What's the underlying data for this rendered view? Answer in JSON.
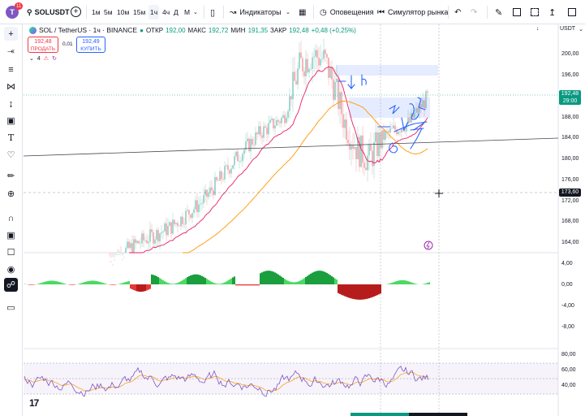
{
  "profile": {
    "initial": "T",
    "notifications": "11"
  },
  "header": {
    "symbol": "SOLUSDT",
    "timeframes": [
      "1м",
      "5м",
      "10м",
      "15м",
      "1ч",
      "4ч",
      "Д",
      "М"
    ],
    "active_timeframe": "1ч",
    "indicators_label": "Индикаторы",
    "alerts_label": "Оповещения",
    "replay_label": "Симулятор рынка"
  },
  "legend": {
    "title": "SOL / TetherUS · 1ч · BINANCE",
    "open_label": "ОТКР",
    "open": "192,00",
    "high_label": "МАКС",
    "high": "192,72",
    "low_label": "МИН",
    "low": "191,35",
    "close_label": "ЗАКР",
    "close": "192,48",
    "change": "+0,48 (+0,25%)",
    "indicators_count": "4"
  },
  "trade": {
    "sell_price": "192,48",
    "sell_label": "ПРОДАТЬ",
    "spread": "0,01",
    "buy_price": "192,49",
    "buy_label": "КУПИТЬ"
  },
  "axis": {
    "currency": "USDT",
    "main_ticks": [
      "200,00",
      "196,00",
      "192,00",
      "188,00",
      "184,00",
      "180,00",
      "176,00",
      "172,00",
      "168,00",
      "164,00"
    ],
    "current_price": "192,48",
    "countdown": "29:00",
    "crosshair_price": "173,60",
    "osc_ticks": [
      "4,00",
      "0,00",
      "-4,00",
      "-8,00"
    ],
    "rsi_ticks": [
      "80,00",
      "60,00",
      "40,00"
    ]
  },
  "colors": {
    "up": "#089981",
    "down": "#f23645",
    "accent": "#2962ff",
    "ma_fast": "#e91e63",
    "ma_slow": "#ff9800",
    "rsi": "#7e57c2"
  }
}
